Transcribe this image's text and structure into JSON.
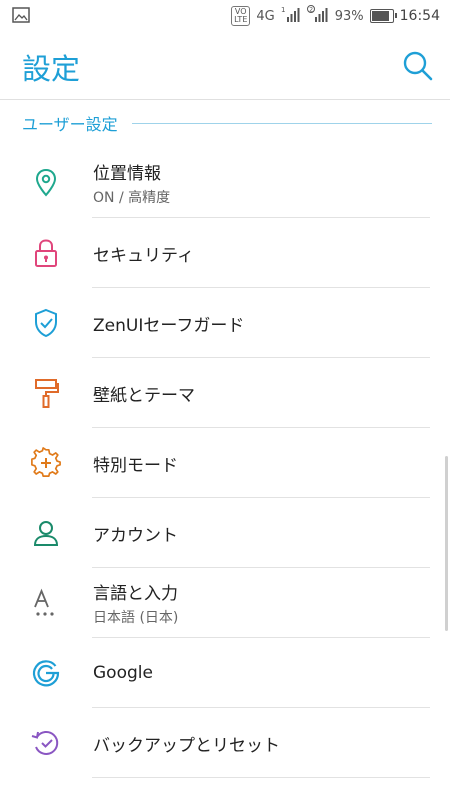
{
  "status_bar": {
    "volte": "VO\nLTE",
    "network": "4G",
    "sim1": "1",
    "sim2": "2",
    "battery": "93%",
    "battery_level": 0.93,
    "time": "16:54"
  },
  "app_bar": {
    "title": "設定",
    "search_icon": "search-icon"
  },
  "section": {
    "label": "ユーザー設定"
  },
  "items": [
    {
      "title": "位置情報",
      "sub": "ON / 高精度",
      "icon": "location-pin-icon",
      "color": "#1fa88e"
    },
    {
      "title": "セキュリティ",
      "sub": "",
      "icon": "lock-icon",
      "color": "#e0457b"
    },
    {
      "title": "ZenUIセーフガード",
      "sub": "",
      "icon": "shield-icon",
      "color": "#1e9fd6"
    },
    {
      "title": "壁紙とテーマ",
      "sub": "",
      "icon": "paint-roller-icon",
      "color": "#e06b2a"
    },
    {
      "title": "特別モード",
      "sub": "",
      "icon": "gear-plus-icon",
      "color": "#e07a1a"
    },
    {
      "title": "アカウント",
      "sub": "",
      "icon": "person-icon",
      "color": "#1a8a6a"
    },
    {
      "title": "言語と入力",
      "sub": "日本語 (日本)",
      "icon": "language-icon",
      "color": "#666666"
    },
    {
      "title": "Google",
      "sub": "",
      "icon": "google-icon",
      "color": "#1e9fd6"
    },
    {
      "title": "バックアップとリセット",
      "sub": "",
      "icon": "backup-restore-icon",
      "color": "#8a56c2"
    }
  ]
}
